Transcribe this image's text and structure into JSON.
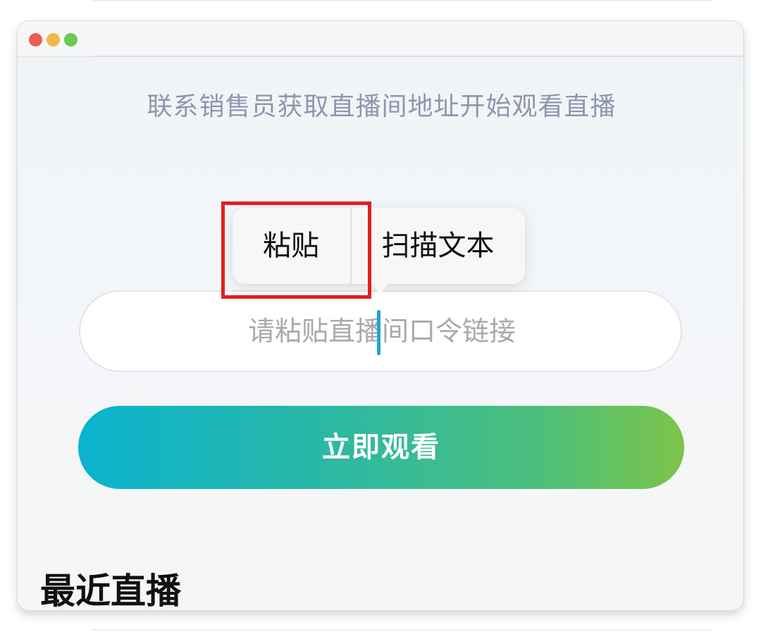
{
  "hint_text": "联系销售员获取直播间地址开始观看直播",
  "context_menu": {
    "items": [
      {
        "label": "粘贴",
        "highlighted": true
      },
      {
        "label": "扫描文本",
        "highlighted": false
      }
    ]
  },
  "link_input": {
    "placeholder": "请粘贴直播间口令链接",
    "value": ""
  },
  "watch_button": {
    "label": "立即观看"
  },
  "recent_section": {
    "title": "最近直播"
  },
  "colors": {
    "highlight_border": "#e02020",
    "button_gradient_start": "#0ab3cf",
    "button_gradient_end": "#7cc44a",
    "caret": "#1ea7d2",
    "hint_text": "#8f96ad"
  }
}
